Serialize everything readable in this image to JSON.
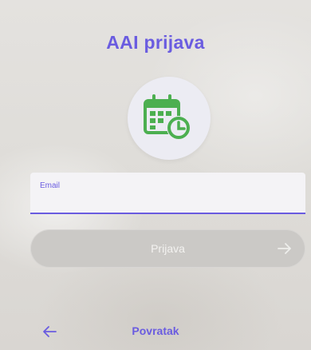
{
  "header": {
    "title": "AAI prijava"
  },
  "logo": {
    "icon": "calendar-clock-icon",
    "color": "#4caf50",
    "bg_color": "#ececf3"
  },
  "form": {
    "email_label": "Email",
    "email_value": "",
    "login_label": "Prijava",
    "login_icon": "arrow-right-icon",
    "login_disabled": true
  },
  "footer": {
    "back_label": "Povratak",
    "back_icon": "arrow-left-icon"
  },
  "colors": {
    "accent": "#6a5ce0",
    "button_disabled": "#cbc9c6",
    "logo_green": "#4caf50"
  }
}
